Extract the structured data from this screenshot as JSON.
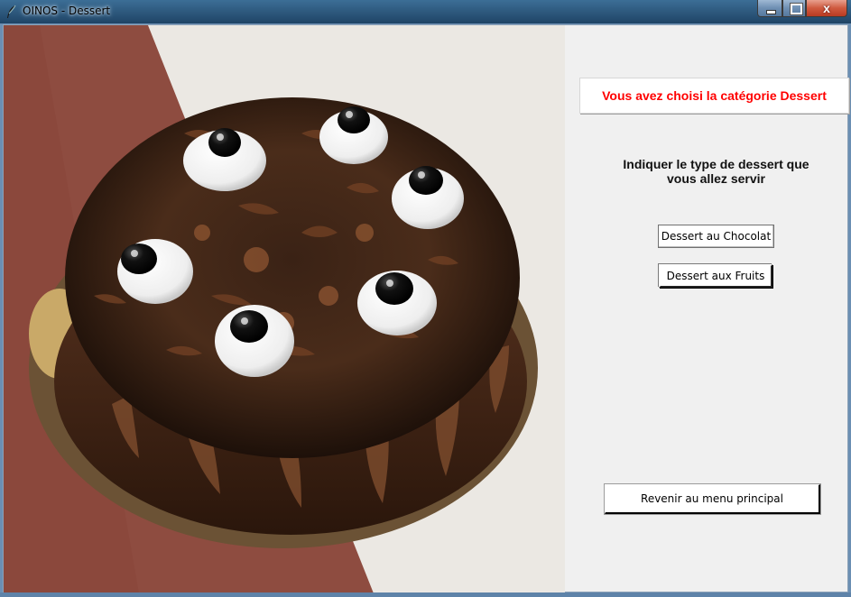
{
  "window": {
    "title": "OINOS - Dessert",
    "icon": "feather-icon",
    "controls": {
      "minimize": "minimize-icon",
      "maximize": "maximize-icon",
      "close": "x"
    }
  },
  "photo": {
    "subject": "chocolate-cake-image"
  },
  "panel": {
    "category_label": "Vous avez choisi la catégorie Dessert",
    "question_line1": "Indiquer le type de dessert que",
    "question_line2": "vous allez servir",
    "chocolate_button": "Dessert au Chocolat",
    "fruit_button": "Dessert aux Fruits",
    "back_button": "Revenir au menu principal"
  },
  "colors": {
    "accent": "#ff0000",
    "window_bg": "#f0f0f0",
    "titlebar": "#2f5b80"
  }
}
